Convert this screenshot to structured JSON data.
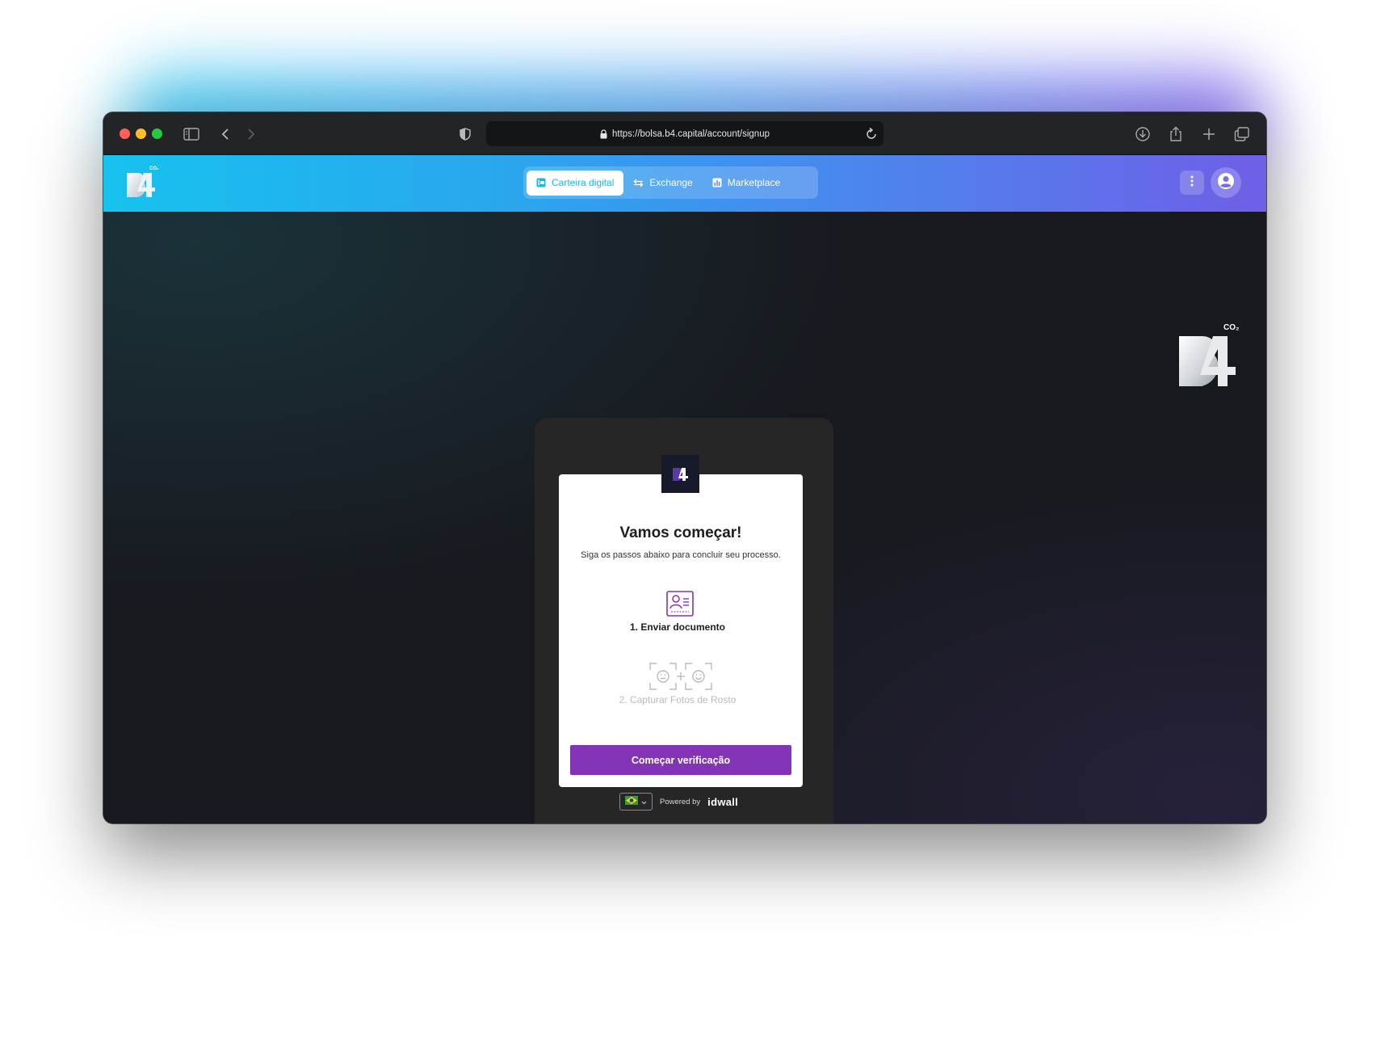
{
  "browser": {
    "url": "https://bolsa.b4.capital/account/signup",
    "icons": [
      "sidebar-icon",
      "back-icon",
      "forward-icon",
      "shield-icon",
      "lock-icon",
      "reload-icon",
      "download-icon",
      "share-icon",
      "new-tab-icon",
      "tabs-overview-icon"
    ]
  },
  "header": {
    "brand": "4",
    "brand_sup": "CO₂",
    "nav": [
      {
        "label": "Carteira digital",
        "active": true,
        "icon": "wallet-icon"
      },
      {
        "label": "Exchange",
        "active": false,
        "icon": "exchange-arrows-icon"
      },
      {
        "label": "Marketplace",
        "active": false,
        "icon": "chart-icon"
      }
    ],
    "colors": {
      "gradient_start": "#17c2ee",
      "gradient_end": "#6f5fe6",
      "active_tab_text": "#18b6ea"
    }
  },
  "brand_large": {
    "text": "4",
    "sup": "CO₂"
  },
  "verification": {
    "title": "Vamos começar!",
    "subtitle": "Siga os passos abaixo para concluir seu processo.",
    "step1": {
      "label": "1. Enviar documento",
      "icon": "id-card-icon"
    },
    "step2": {
      "label": "2. Capturar Fotos de Rosto",
      "icon": "face-capture-icon"
    },
    "button": "Começar verificação",
    "accent": "#8334b6"
  },
  "footer": {
    "language_flag": "brazil-flag",
    "powered_by": "Powered by",
    "provider": "idwall"
  }
}
